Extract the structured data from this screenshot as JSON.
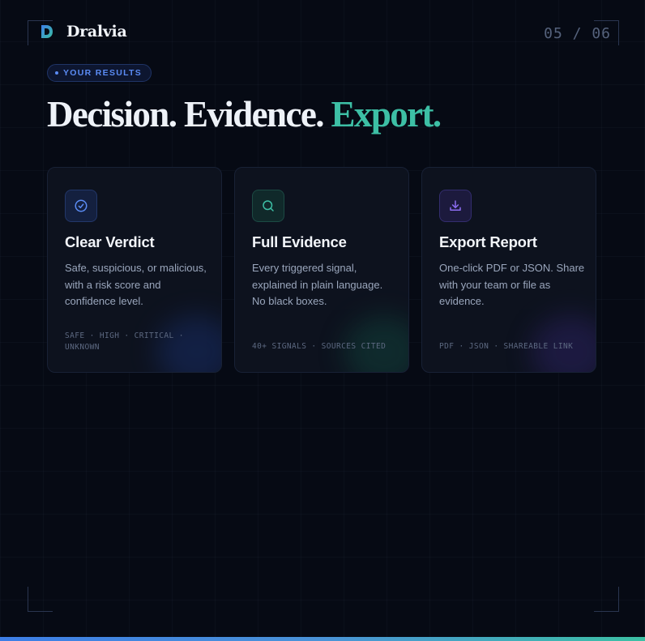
{
  "brand": {
    "name": "Dralvia",
    "logo_icon": "d-logo-icon"
  },
  "page_counter": "05 / 06",
  "badge": {
    "label": "YOUR RESULTS"
  },
  "headline": {
    "part1": "Decision.",
    "part2": "Evidence.",
    "part3": "Export."
  },
  "cards": [
    {
      "icon": "check-circle-icon",
      "title": "Clear Verdict",
      "description": "Safe, suspicious, or malicious, with a risk score and confidence level.",
      "tags": "SAFE · HIGH · CRITICAL · UNKNOWN"
    },
    {
      "icon": "search-icon",
      "title": "Full Evidence",
      "description": "Every triggered signal, explained in plain language. No black boxes.",
      "tags": "40+ SIGNALS · SOURCES CITED"
    },
    {
      "icon": "download-icon",
      "title": "Export Report",
      "description": "One-click PDF or JSON. Share with your team or file as evidence.",
      "tags": "PDF · JSON · SHAREABLE LINK"
    }
  ],
  "colors": {
    "background": "#060a14",
    "accent_blue": "#5b8cf5",
    "accent_teal": "#3dbfa5",
    "accent_purple": "#8b6cf0"
  }
}
